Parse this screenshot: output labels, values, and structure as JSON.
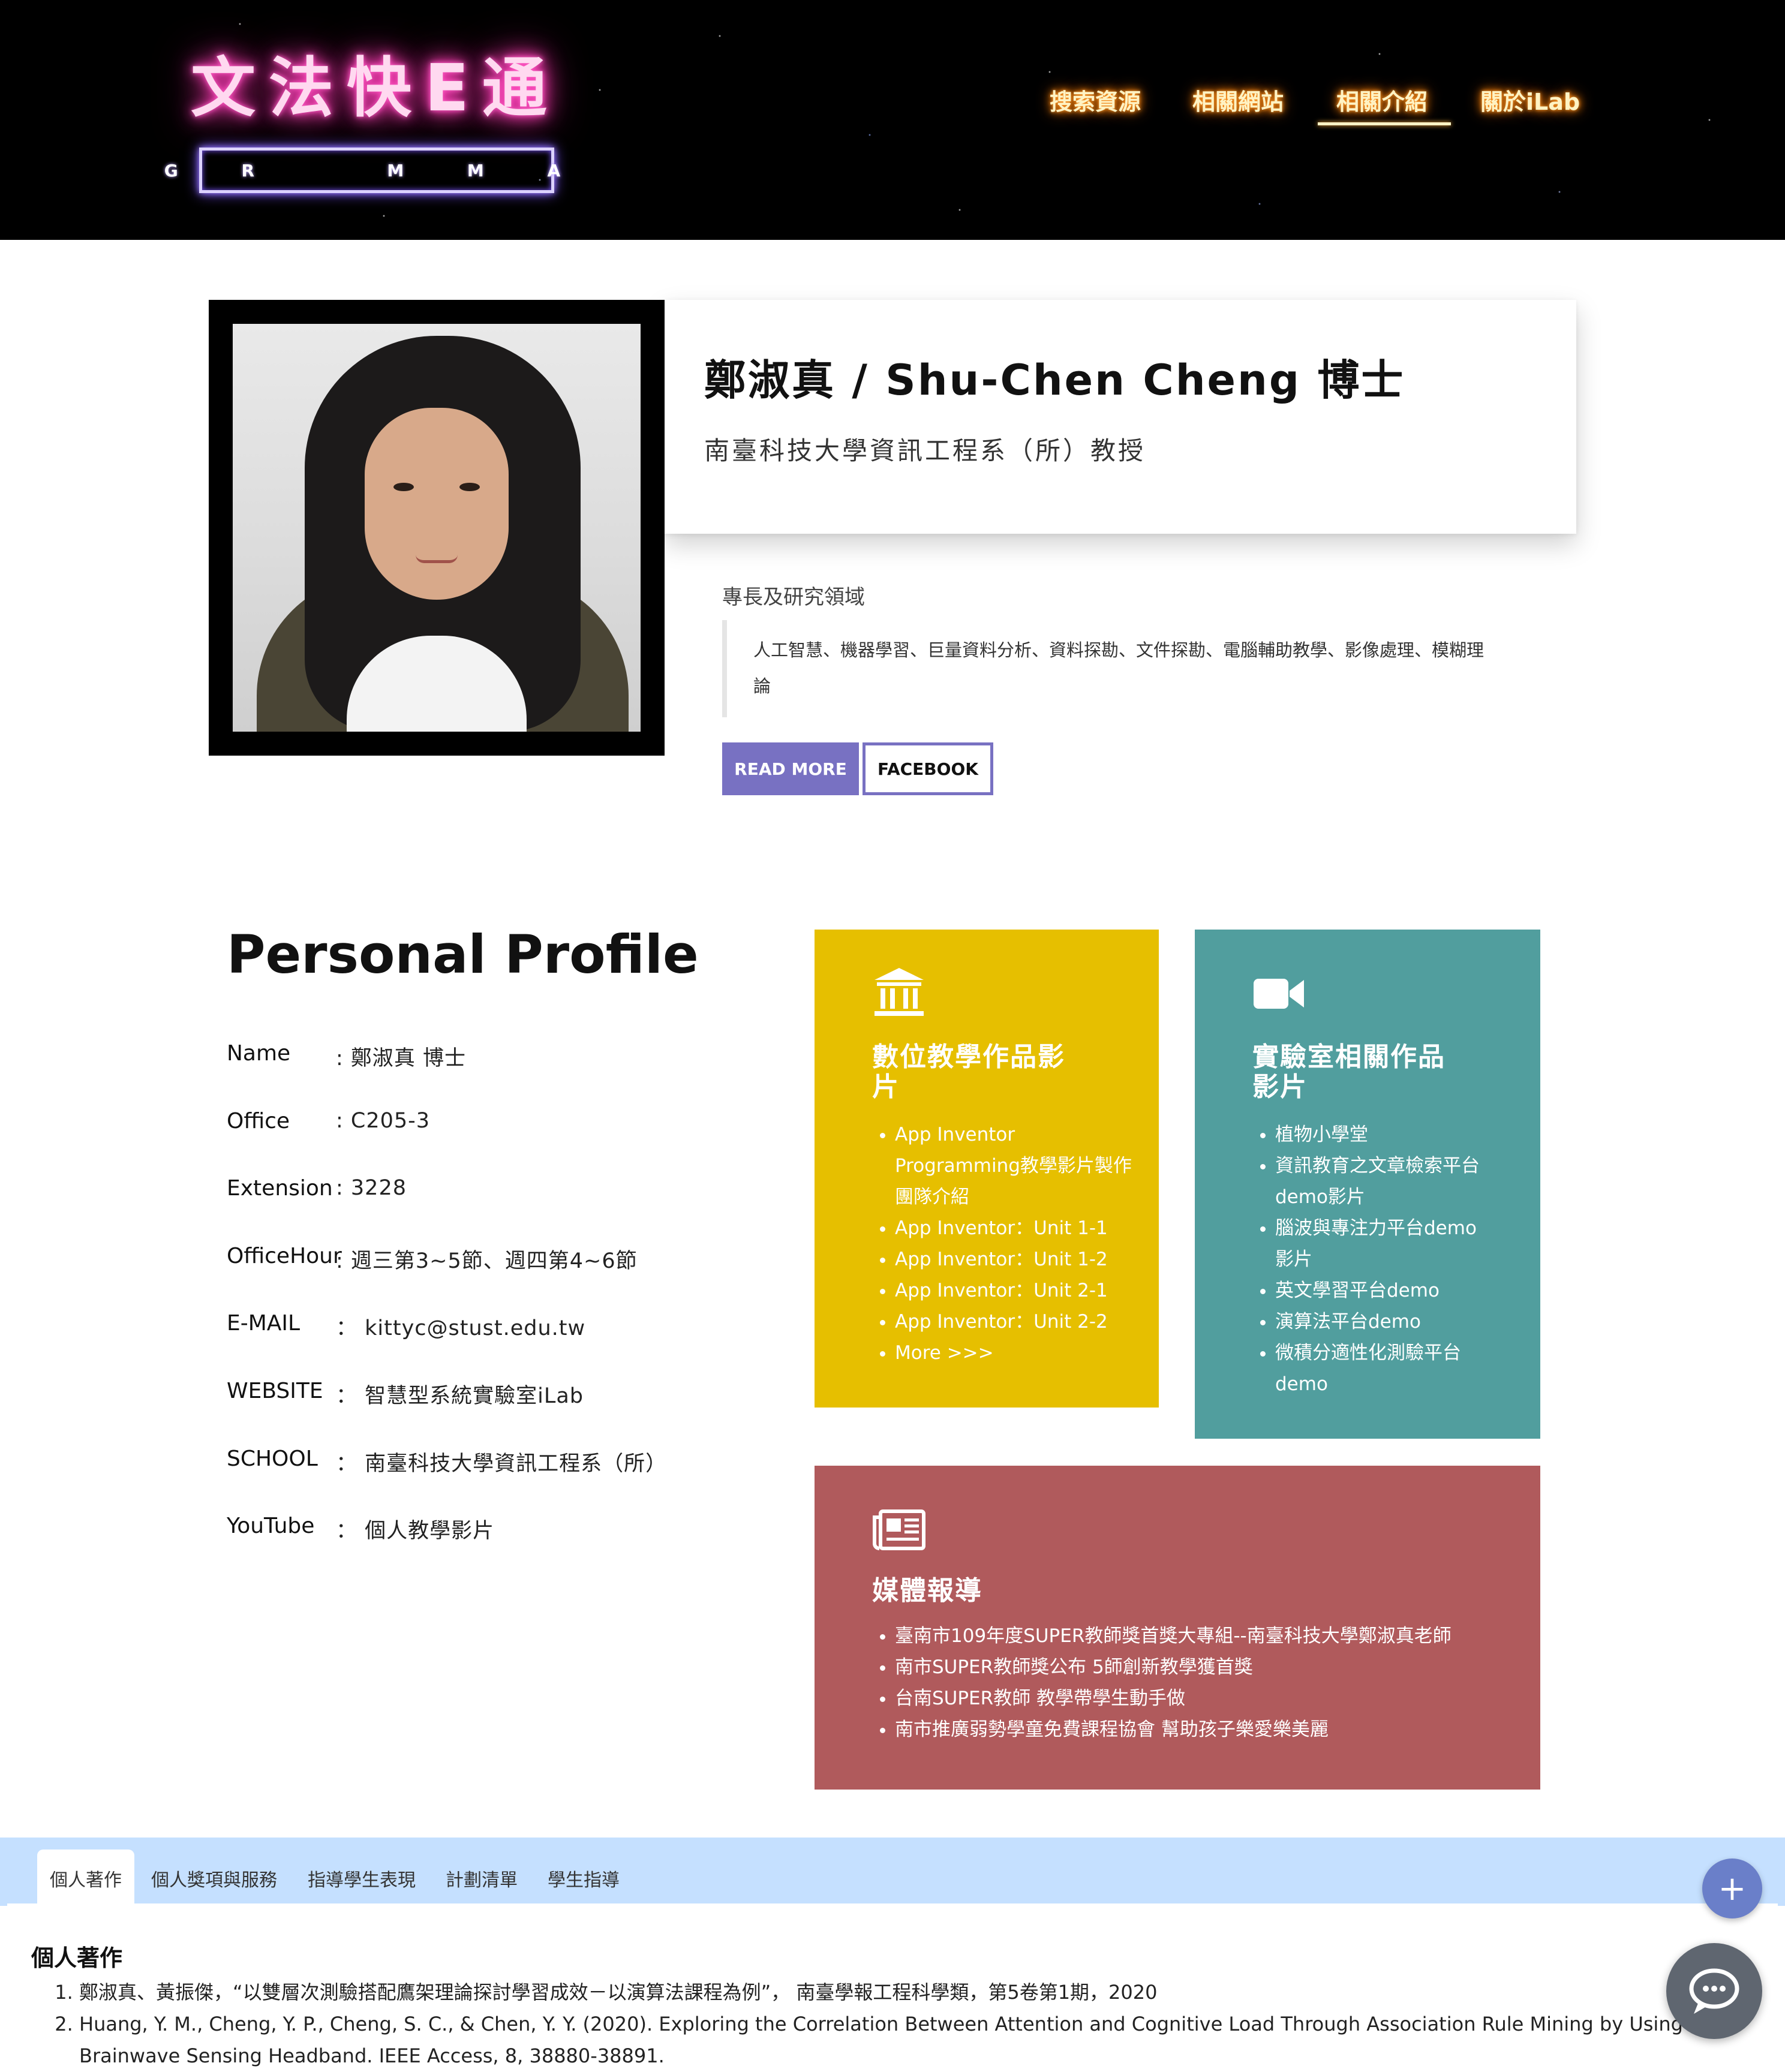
{
  "header": {
    "logo_title": "文法快E通",
    "logo_subtitle": "G R   M M A",
    "nav": [
      {
        "label": "搜索資源"
      },
      {
        "label": "相關網站"
      },
      {
        "label": "相關介紹",
        "active": true
      },
      {
        "label": "關於iLab"
      }
    ]
  },
  "hero": {
    "name_title": "鄭淑真 / Shu-Chen Cheng 博士",
    "position": "南臺科技大學資訊工程系（所）教授",
    "research_label": "專長及研究領域",
    "research_text": "人工智慧、機器學習、巨量資料分析、資料探勘、文件探勘、電腦輔助教學、影像處理、模糊理論",
    "read_more": "READ MORE",
    "facebook": "FACEBOOK"
  },
  "profile": {
    "heading": "Personal Profile",
    "rows": [
      {
        "label": "Name",
        "value": ": 鄭淑真 博士"
      },
      {
        "label": "Office",
        "value": ": C205-3"
      },
      {
        "label": "Extension",
        "value": ": 3228"
      },
      {
        "label": "OfficeHour",
        "value": ": 週三第3~5節、週四第4~6節"
      },
      {
        "label": "E-MAIL",
        "value": "： kittyc@stust.edu.tw"
      },
      {
        "label": "WEBSITE",
        "value": "： 智慧型系統實驗室iLab"
      },
      {
        "label": "SCHOOL",
        "value": "： 南臺科技大學資訊工程系（所）"
      },
      {
        "label": "YouTube",
        "value": "： 個人教學影片"
      }
    ]
  },
  "cards": {
    "teaching": {
      "icon": "bank-icon",
      "color": "#e6bf00",
      "title_line1": "數位教學作品影",
      "title_line2": "片",
      "items": [
        "App Inventor Programming教學影片製作團隊介紹",
        "App Inventor：Unit 1-1",
        "App Inventor：Unit 1-2",
        "App Inventor：Unit 2-1",
        "App Inventor：Unit 2-2",
        "More >>>"
      ]
    },
    "lab": {
      "icon": "video-camera-icon",
      "color": "#519e9e",
      "title_line1": "實驗室相關作品",
      "title_line2": "影片",
      "items": [
        "植物小學堂",
        "資訊教育之文章檢索平台demo影片",
        "腦波與專注力平台demo影片",
        "英文學習平台demo",
        "演算法平台demo",
        "微積分適性化測驗平台demo"
      ]
    },
    "media": {
      "icon": "newspaper-icon",
      "color": "#b05a5c",
      "title": "媒體報導",
      "items": [
        "臺南市109年度SUPER教師獎首獎大專組--南臺科技大學鄭淑真老師",
        "南市SUPER教師獎公布 5師創新教學獲首獎",
        "台南SUPER教師 教學帶學生動手做",
        "南市推廣弱勢學童免費課程協會 幫助孩子樂愛樂美麗"
      ]
    }
  },
  "tabs": {
    "items": [
      {
        "label": "個人著作",
        "active": true
      },
      {
        "label": "個人獎項與服務"
      },
      {
        "label": "指導學生表現"
      },
      {
        "label": "計劃清單"
      },
      {
        "label": "學生指導"
      }
    ],
    "section_heading": "個人著作",
    "publications": [
      "鄭淑真、黃振傑，“以雙層次測驗搭配鷹架理論探討學習成效－以演算法課程為例”， 南臺學報工程科學類，第5卷第1期，2020",
      "Huang, Y. M., Cheng, Y. P., Cheng, S. C., & Chen, Y. Y. (2020). Exploring the Correlation Between Attention and Cognitive Load Through Association Rule Mining by Using a Brainwave Sensing Headband. IEEE Access, 8, 38880-38891."
    ]
  },
  "widgets": {
    "fab_label": "+",
    "fab_icon": "plus-icon",
    "chat_icon": "chat-bubble-icon"
  }
}
